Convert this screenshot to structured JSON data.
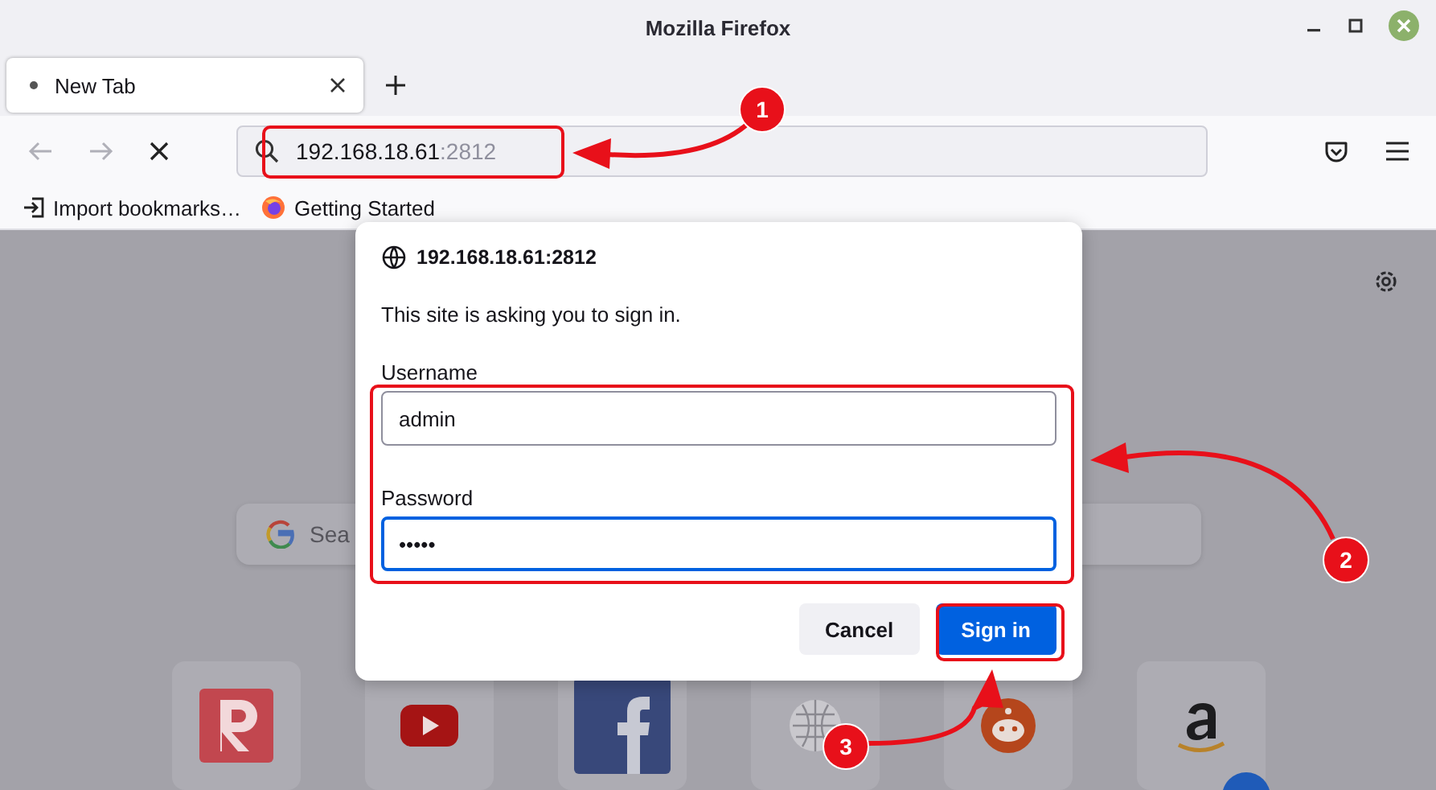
{
  "window": {
    "title": "Mozilla Firefox"
  },
  "tabs": [
    {
      "label": "New Tab",
      "selected": true
    }
  ],
  "navbar": {
    "url_host": "192.168.18.61",
    "url_port": ":2812"
  },
  "bookmarks": [
    {
      "label": "Import bookmarks…",
      "kind": "import"
    },
    {
      "label": "Getting Started",
      "kind": "firefox"
    }
  ],
  "new_tab": {
    "search_placeholder": "Sea",
    "top_sites": [
      {
        "kind": "letter-r"
      },
      {
        "kind": "youtube"
      },
      {
        "kind": "facebook"
      },
      {
        "kind": "wikipedia"
      },
      {
        "kind": "reddit"
      },
      {
        "kind": "amazon"
      }
    ]
  },
  "dialog": {
    "origin": "192.168.18.61:2812",
    "message": "This site is asking you to sign in.",
    "fields": [
      {
        "label": "Username",
        "value": "admin",
        "focused": false
      },
      {
        "label": "Password",
        "value": "•••••",
        "focused": true
      }
    ],
    "buttons": [
      {
        "label": "Cancel",
        "kind": "secondary"
      },
      {
        "label": "Sign in",
        "kind": "primary"
      }
    ]
  },
  "annotations": [
    {
      "number": "1"
    },
    {
      "number": "2"
    },
    {
      "number": "3"
    }
  ]
}
